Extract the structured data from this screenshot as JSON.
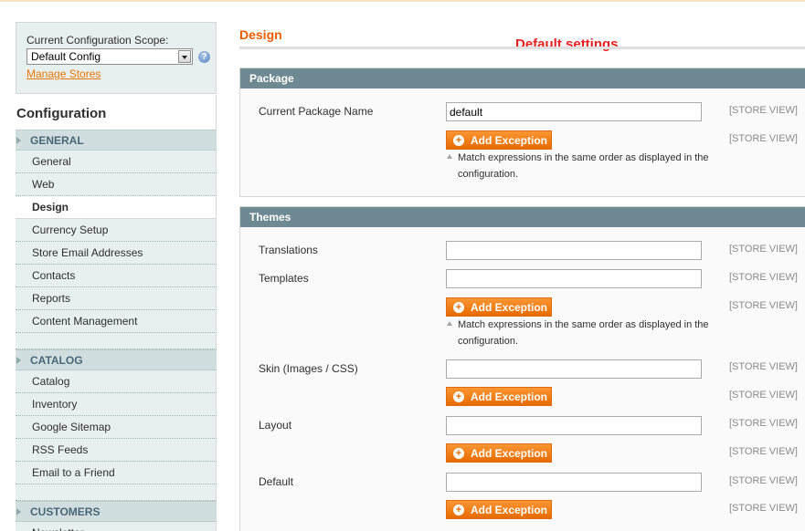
{
  "scope": {
    "label": "Current Configuration Scope:",
    "selected": "Default Config",
    "manage_link": "Manage Stores"
  },
  "config_title": "Configuration",
  "nav": {
    "general_section": "GENERAL",
    "general_items": [
      "General",
      "Web",
      "Design",
      "Currency Setup",
      "Store Email Addresses",
      "Contacts",
      "Reports",
      "Content Management"
    ],
    "catalog_section": "CATALOG",
    "catalog_items": [
      "Catalog",
      "Inventory",
      "Google Sitemap",
      "RSS Feeds",
      "Email to a Friend"
    ],
    "customers_section": "CUSTOMERS",
    "customers_items": [
      "Newsletter"
    ]
  },
  "main": {
    "page_title": "Design",
    "annotation": "Default settings",
    "package": {
      "header": "Package",
      "package_label": "Current Package Name",
      "package_value": "default",
      "scope": "[STORE VIEW]",
      "add_exception": "Add Exception",
      "note": "Match expressions in the same order as displayed in the configuration."
    },
    "themes": {
      "header": "Themes",
      "translations_label": "Translations",
      "templates_label": "Templates",
      "skin_label": "Skin (Images / CSS)",
      "layout_label": "Layout",
      "default_label": "Default",
      "scope": "[STORE VIEW]",
      "add_exception": "Add Exception",
      "note": "Match expressions in the same order as displayed in the configuration."
    }
  },
  "colors": {
    "accent_orange": "#eb5e00",
    "button_orange": "#f08221",
    "section_header": "#6f8992",
    "annotation_red": "#e62020"
  }
}
